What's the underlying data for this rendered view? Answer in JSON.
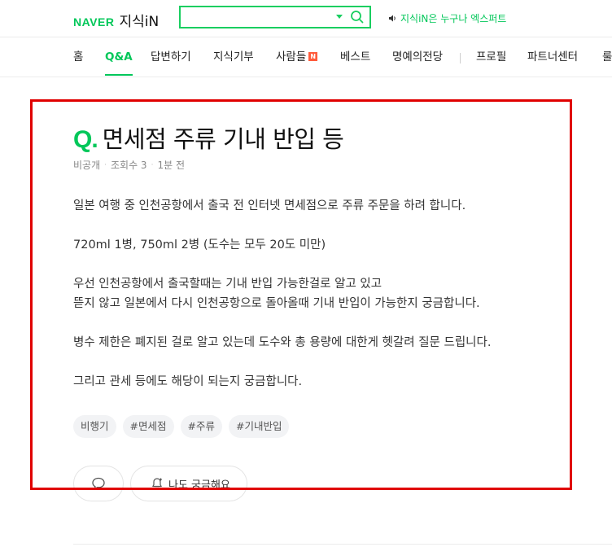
{
  "header": {
    "brand": "NAVER",
    "service": "지식iN",
    "search": {
      "value": "",
      "placeholder": ""
    },
    "notice": "지식iN은 누구나 엑스퍼트"
  },
  "nav": {
    "items": [
      {
        "label": "홈"
      },
      {
        "label": "Q&A",
        "active": true
      },
      {
        "label": "답변하기"
      },
      {
        "label": "지식기부"
      },
      {
        "label": "사람들",
        "badge": "N"
      },
      {
        "label": "베스트"
      },
      {
        "label": "명예의전당"
      },
      {
        "label": "프로필"
      },
      {
        "label": "파트너센터"
      },
      {
        "label": "룰"
      }
    ]
  },
  "question": {
    "q_mark": "Q.",
    "title": "면세점 주류 기내 반입 등",
    "meta": {
      "author": "비공개",
      "views": "조회수 3",
      "time": "1분 전"
    },
    "body": [
      "일본 여행 중 인천공항에서 출국 전 인터넷 면세점으로 주류 주문을 하려 합니다.",
      "720ml 1병, 750ml 2병 (도수는 모두 20도 미만)",
      "우선 인천공항에서 출국할때는 기내 반입 가능한걸로 알고 있고",
      "뜯지 않고 일본에서 다시 인천공항으로 돌아올때 기내 반입이 가능한지 궁금합니다.",
      "병수 제한은 폐지된 걸로 알고 있는데 도수와 총 용량에 대한게 헷갈려 질문 드립니다.",
      "그리고 관세 등에도 해당이 되는지 궁금합니다."
    ],
    "tags": [
      "비행기",
      "#면세점",
      "#주류",
      "#기내반입"
    ],
    "curious_label": "나도 궁금해요"
  },
  "colors": {
    "accent": "#03c75a",
    "focus_box": "#e00000"
  }
}
